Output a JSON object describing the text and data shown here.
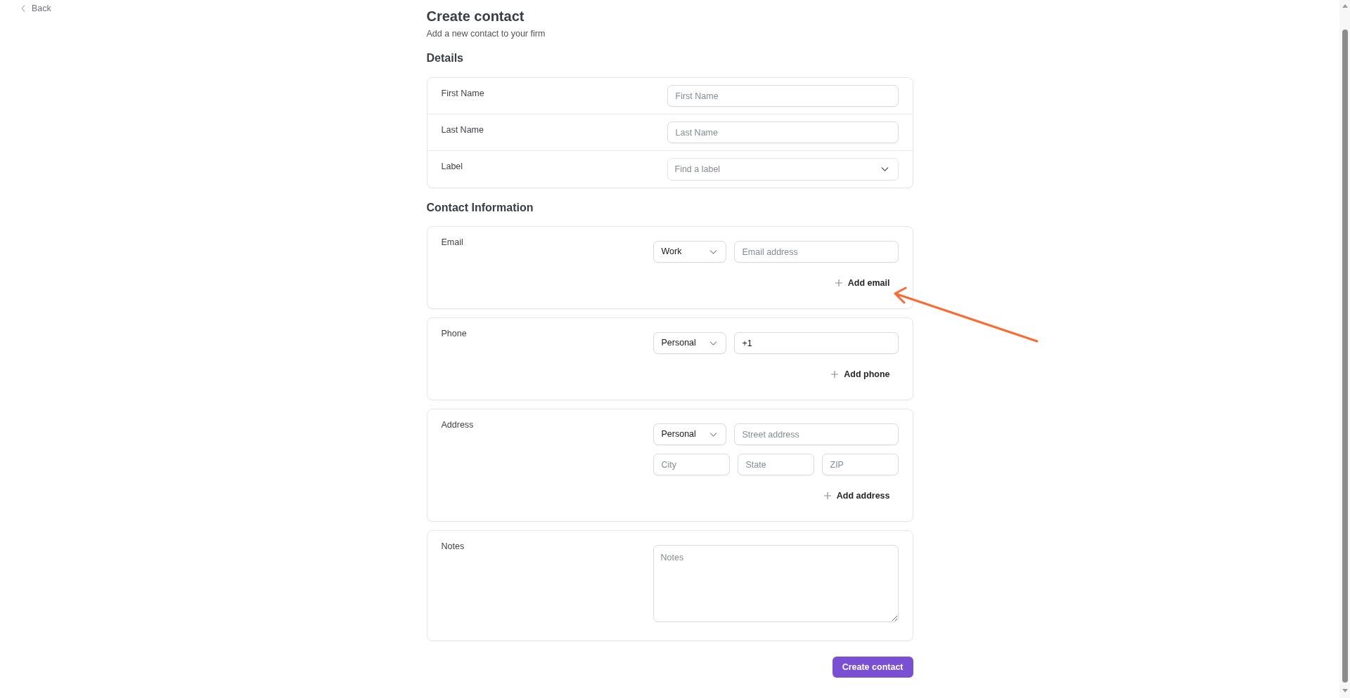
{
  "back_link": {
    "label": "Back"
  },
  "header": {
    "title": "Create contact",
    "subtitle": "Add a new contact to your firm"
  },
  "details": {
    "heading": "Details",
    "rows": [
      {
        "label": "First Name",
        "field": {
          "kind": "text",
          "placeholder": "First Name"
        }
      },
      {
        "label": "Last Name",
        "field": {
          "kind": "text",
          "placeholder": "Last Name"
        }
      },
      {
        "label": "Label",
        "field": {
          "kind": "combobox",
          "placeholder": "Find a label"
        }
      }
    ]
  },
  "contact_information": {
    "heading": "Contact Information",
    "cards": [
      {
        "kind": "entries",
        "label": "Email",
        "field_rows": [
          [
            {
              "kind": "select",
              "value": "Work"
            },
            {
              "kind": "text",
              "placeholder": "Email address"
            }
          ]
        ],
        "add_button": "Add email"
      },
      {
        "kind": "entries",
        "label": "Phone",
        "field_rows": [
          [
            {
              "kind": "select",
              "value": "Personal"
            },
            {
              "kind": "text",
              "value": "+1"
            }
          ]
        ],
        "add_button": "Add phone"
      },
      {
        "kind": "entries",
        "label": "Address",
        "field_rows": [
          [
            {
              "kind": "select",
              "value": "Personal"
            },
            {
              "kind": "text",
              "placeholder": "Street address"
            }
          ],
          [
            {
              "kind": "text",
              "placeholder": "City"
            },
            {
              "kind": "text",
              "placeholder": "State"
            },
            {
              "kind": "text",
              "placeholder": "ZIP"
            }
          ]
        ],
        "add_button": "Add address"
      },
      {
        "kind": "notes",
        "label": "Notes",
        "field": {
          "kind": "textarea",
          "placeholder": "Notes"
        }
      }
    ]
  },
  "submit_button": {
    "label": "Create contact"
  }
}
